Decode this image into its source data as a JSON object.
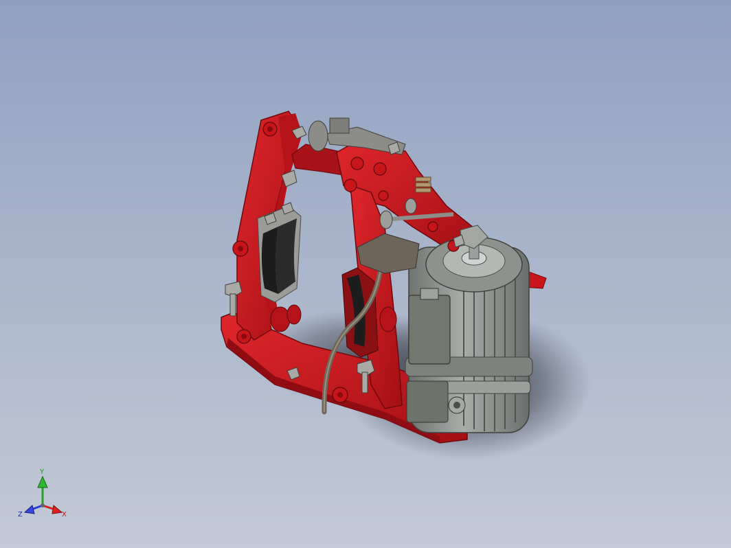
{
  "viewport": {
    "background_top": "#8fa0bf",
    "background_bottom": "#c3c9d6"
  },
  "model": {
    "frame_color": "#c8141b",
    "motor_color": "#8a8f8c",
    "pad_color": "#1d1d1d",
    "bolt_color": "#a9aaa6",
    "cable_color": "#6f675a"
  },
  "triad": {
    "y_label": "Y",
    "x_label": "X",
    "z_label": "Z",
    "y_color": "#27a327",
    "x_color": "#d22020",
    "z_color": "#2a3fcf"
  }
}
